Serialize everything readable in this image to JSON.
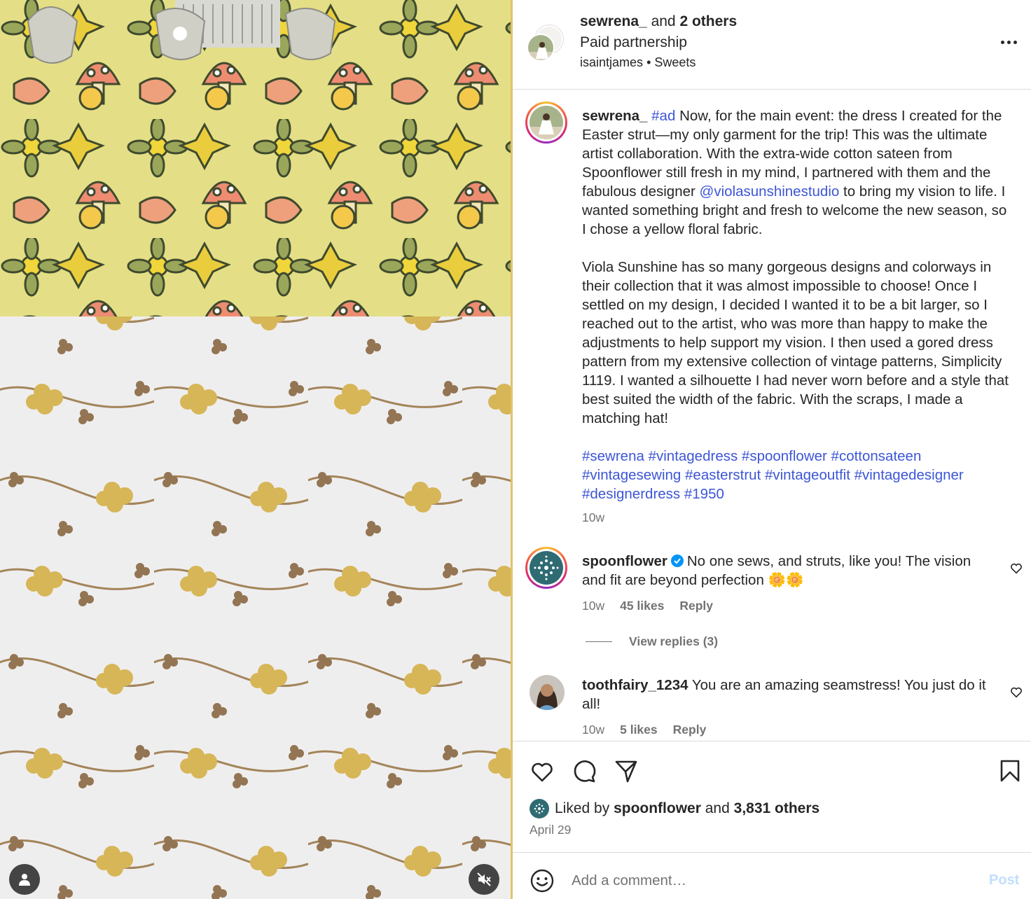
{
  "media": {
    "user_tag_icon": "person-icon",
    "mute_icon": "speaker-muted-icon"
  },
  "header": {
    "username": "sewrena_",
    "and_text": "and",
    "others": "2 others",
    "partnership": "Paid partnership",
    "tagged_account": "isaintjames",
    "separator": "•",
    "audio": "Sweets",
    "more_icon": "ellipsis-icon"
  },
  "caption": {
    "username": "sewrena_",
    "tag_ad": "#ad",
    "p1_a": "Now, for the main event: the dress I created for the Easter strut—my only garment for the trip! This was the ultimate artist collaboration. With the extra-wide cotton sateen from Spoonflower still fresh in my mind, I partnered with them and the fabulous designer",
    "mention": "@violasunshinestudio",
    "p1_b": "to bring my vision to life. I wanted something bright and fresh to welcome the new season, so I chose a yellow floral fabric.",
    "p2": "Viola Sunshine has so many gorgeous designs and colorways in their collection that it was almost impossible to choose! Once I settled on my design, I decided I wanted it to be a bit larger, so I reached out to the artist, who was more than happy to make the adjustments to help support my vision. I then used a gored dress pattern from my extensive collection of vintage patterns, Simplicity 1119. I wanted a silhouette I had never worn before and a style that best suited the width of the fabric. With the scraps, I made a matching hat!",
    "hashtags": "#sewrena #vintagedress #spoonflower #cottonsateen #vintagesewing #easterstrut #vintageoutfit #vintagedesigner #designerdress #1950",
    "time": "10w"
  },
  "comments": [
    {
      "username": "spoonflower",
      "verified": true,
      "text": "No one sews, and struts, like you! The vision and fit are beyond perfection 🌼🌼",
      "time": "10w",
      "likes": "45 likes",
      "reply": "Reply",
      "view_replies": "View replies (3)"
    },
    {
      "username": "toothfairy_1234",
      "text": "You are an amazing seamstress! You just do it all!",
      "time": "10w",
      "likes": "5 likes",
      "reply": "Reply"
    }
  ],
  "actions": {
    "like_icon": "heart-icon",
    "comment_icon": "comment-icon",
    "share_icon": "paper-plane-icon",
    "save_icon": "bookmark-icon"
  },
  "likes": {
    "prefix": "Liked by",
    "user": "spoonflower",
    "and_text": "and",
    "others": "3,831 others"
  },
  "date": "April 29",
  "add_comment": {
    "placeholder": "Add a comment…",
    "post_label": "Post"
  },
  "colors": {
    "link": "#3d56d6",
    "muted": "#737373",
    "post_disabled": "#c0dffd",
    "verified": "#0095f6"
  }
}
